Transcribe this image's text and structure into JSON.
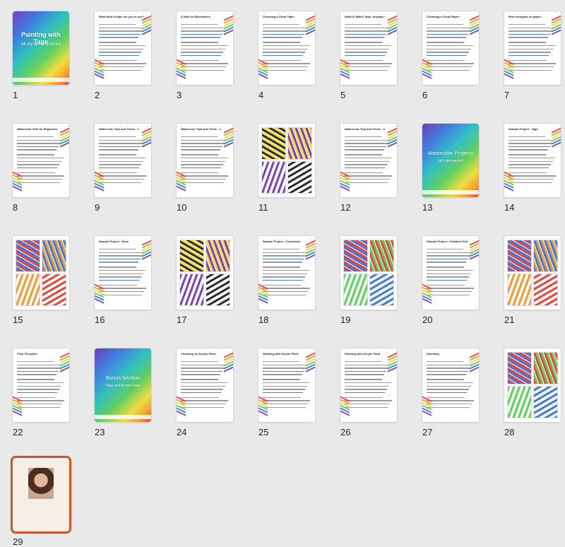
{
  "pages": [
    {
      "n": "1",
      "type": "cover",
      "title": "Painting with Tape",
      "subtitle": "All my tips and tricks!"
    },
    {
      "n": "2",
      "type": "text",
      "title": "What kind of tape are you to use?"
    },
    {
      "n": "3",
      "type": "text",
      "title": "A Note on Boundaries"
    },
    {
      "n": "4",
      "type": "text",
      "title": "Choosing a Good Tape!"
    },
    {
      "n": "5",
      "type": "text",
      "title": "What is Washi Tape, Anyway?"
    },
    {
      "n": "6",
      "type": "text",
      "title": "Choosing a Good Paper!"
    },
    {
      "n": "7",
      "type": "text",
      "title": "More thoughts on paper..."
    },
    {
      "n": "8",
      "type": "text",
      "title": "Watercolor Sets for Beginners"
    },
    {
      "n": "9",
      "type": "text",
      "title": "Watercolor Tips and Tricks - 1"
    },
    {
      "n": "10",
      "type": "text",
      "title": "Watercolor Tips and Tricks - 2"
    },
    {
      "n": "11",
      "type": "photos",
      "title": ""
    },
    {
      "n": "12",
      "type": "text",
      "title": "Watercolor Tips and Tricks - 3"
    },
    {
      "n": "13",
      "type": "cover2",
      "title": "Watercolor Projects",
      "subtitle": "Let's get started!"
    },
    {
      "n": "14",
      "type": "text",
      "title": "Sample Project - Jags"
    },
    {
      "n": "15",
      "type": "photos",
      "title": ""
    },
    {
      "n": "16",
      "type": "text",
      "title": "Sample Project - Rose"
    },
    {
      "n": "17",
      "type": "photos",
      "title": ""
    },
    {
      "n": "18",
      "type": "text",
      "title": "Sample Project - Cornerkeel"
    },
    {
      "n": "19",
      "type": "photos",
      "title": ""
    },
    {
      "n": "20",
      "type": "text",
      "title": "Sample Project - Gradient Grid"
    },
    {
      "n": "21",
      "type": "photos",
      "title": ""
    },
    {
      "n": "22",
      "type": "text",
      "title": "Final Thoughts"
    },
    {
      "n": "23",
      "type": "cover2",
      "title": "Bonus Section",
      "subtitle": "Tape and Acrylic Paint"
    },
    {
      "n": "24",
      "type": "text",
      "title": "Choosing an Acrylic Paint"
    },
    {
      "n": "25",
      "type": "text",
      "title": "Working with Acrylic Paint"
    },
    {
      "n": "26",
      "type": "text",
      "title": "Working with Acrylic Paint"
    },
    {
      "n": "27",
      "type": "text",
      "title": "Summary"
    },
    {
      "n": "28",
      "type": "photos",
      "title": ""
    },
    {
      "n": "29",
      "type": "cover3",
      "title": "",
      "subtitle": ""
    }
  ],
  "colors": {
    "accent": "#c9552b",
    "link": "#4b7fd1"
  }
}
